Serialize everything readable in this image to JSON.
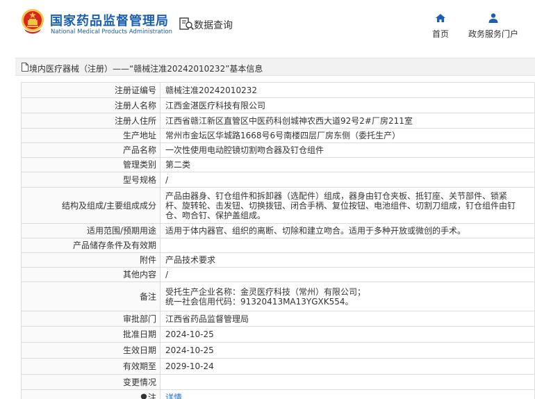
{
  "header": {
    "logo_cn": "国家药品监督管理局",
    "logo_en": "National Medical Products Administration",
    "query_label": "数据查询",
    "nav": [
      {
        "label": "首页",
        "icon": "home-icon"
      },
      {
        "label": "政务服务门户",
        "icon": "user-icon"
      }
    ]
  },
  "breadcrumb": {
    "text": "境内医疗器械（注册）——“赣械注准20242010232”基本信息",
    "icon": "document-icon"
  },
  "table": {
    "rows": [
      {
        "key": "注册证编号",
        "value": "赣械注准20242010232"
      },
      {
        "key": "注册人名称",
        "value": "江西金湛医疗科技有限公司"
      },
      {
        "key": "注册人住所",
        "value": "江西省赣江新区直管区中医药科创城神农西大道92号2#厂房211室"
      },
      {
        "key": "生产地址",
        "value": "常州市金坛区华城路1668号6号南楼四层厂房东侧（委托生产）"
      },
      {
        "key": "产品名称",
        "value": "一次性使用电动腔镜切割吻合器及钉仓组件"
      },
      {
        "key": "管理类别",
        "value": "第二类"
      },
      {
        "key": "型号规格",
        "value": "/"
      },
      {
        "key": "结构及组成/主要组成成分",
        "value_lines": [
          "产品由器身、钉仓组件和拆卸器（选配件）组成，器身由钉仓夹板、抵钉座、关节部件、锁紧",
          "杆、旋转轮、击发钮、切换拨钮、闭合手柄、复位按钮、电池组件、切割刀组成，钉仓组件由钉",
          "仓、吻合钉、保护盖组成。"
        ]
      },
      {
        "key": "适用范围/预期用途",
        "value": "适用于体内器官、组织的离断、切除和建立吻合。适用于多种开放或微创的手术。"
      },
      {
        "key": "产品储存条件及有效期",
        "value": ""
      },
      {
        "key": "附件",
        "value": "产品技术要求"
      },
      {
        "key": "其他内容",
        "value": "/"
      },
      {
        "key": "备注",
        "value_lines": [
          "受托生产企业名称：金灵医疗科技（常州）有限公司；",
          "统一社会信用代码：91320413MA13YGXK554。"
        ]
      },
      {
        "key": "审批部门",
        "value": "江西省药品监督管理局"
      },
      {
        "key": "批准日期",
        "value": "2024-10-25"
      },
      {
        "key": "生效日期",
        "value": "2024-10-25"
      },
      {
        "key": "有效期至",
        "value": "2029-10-24"
      },
      {
        "key": "变更情况",
        "value": ""
      },
      {
        "key": "注",
        "value": "详情",
        "key_icon": "lightbulb-icon"
      }
    ]
  },
  "colors": {
    "brand": "#1a5fb4",
    "emblem_red": "#d7261e",
    "emblem_gold": "#f5c242",
    "link": "#1a6fcf",
    "border": "#dcdcdc"
  }
}
